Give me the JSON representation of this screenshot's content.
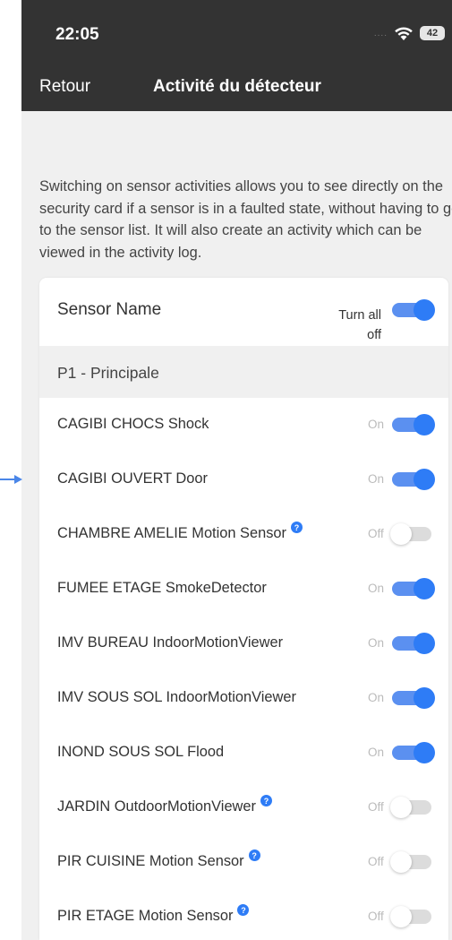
{
  "status_bar": {
    "time": "22:05",
    "signal": "....",
    "battery": "42"
  },
  "nav": {
    "back_label": "Retour",
    "title": "Activité du détecteur"
  },
  "description": "Switching on sensor activities allows you to see directly on the security card if a sensor is in a faulted state, without having to go to the sensor list. It will also create an activity which can be viewed in the activity log.",
  "table": {
    "column_title": "Sensor Name",
    "turn_all_label": "Turn all off",
    "turn_all_on": true,
    "group": "P1 - Principale",
    "help_symbol": "?",
    "sensors": [
      {
        "name": "CAGIBI CHOCS Shock",
        "state": "On",
        "on": true,
        "help": false
      },
      {
        "name": "CAGIBI OUVERT Door",
        "state": "On",
        "on": true,
        "help": false
      },
      {
        "name": "CHAMBRE AMELIE Motion Sensor",
        "state": "Off",
        "on": false,
        "help": true
      },
      {
        "name": "FUMEE ETAGE SmokeDetector",
        "state": "On",
        "on": true,
        "help": false
      },
      {
        "name": "IMV BUREAU IndoorMotionViewer",
        "state": "On",
        "on": true,
        "help": false
      },
      {
        "name": "IMV SOUS SOL IndoorMotionViewer",
        "state": "On",
        "on": true,
        "help": false
      },
      {
        "name": "INOND SOUS SOL Flood",
        "state": "On",
        "on": true,
        "help": false
      },
      {
        "name": "JARDIN OutdoorMotionViewer",
        "state": "Off",
        "on": false,
        "help": true
      },
      {
        "name": "PIR CUISINE Motion Sensor",
        "state": "Off",
        "on": false,
        "help": true
      },
      {
        "name": "PIR ETAGE Motion Sensor",
        "state": "Off",
        "on": false,
        "help": true
      }
    ]
  },
  "colors": {
    "accent": "#2e7cf6",
    "header_bg": "#333333",
    "page_bg": "#f0f0f0"
  }
}
